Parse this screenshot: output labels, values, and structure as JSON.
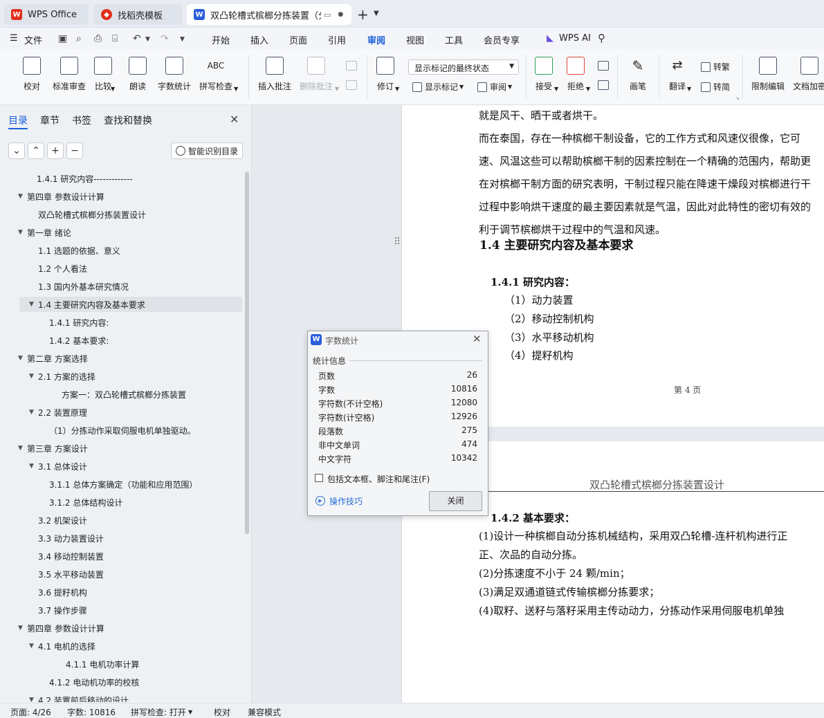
{
  "tabs": [
    {
      "label": "WPS Office",
      "icon": "wps-logo-icon",
      "color": "#e0301e"
    },
    {
      "label": "找稻壳模板",
      "icon": "docer-icon",
      "color": "#e0301e"
    },
    {
      "label": "双凸轮槽式槟榔分拣装置（分",
      "icon": "word-doc-icon",
      "color": "#2b5fd9"
    }
  ],
  "tab_add": "+",
  "menu": {
    "file": "文件",
    "items": [
      "开始",
      "插入",
      "页面",
      "引用",
      "审阅",
      "视图",
      "工具",
      "会员专享"
    ],
    "active": "审阅",
    "ai": "WPS AI"
  },
  "ribbon": {
    "proofread": "校对",
    "standard_review": "标准审查",
    "compare": "比较",
    "read_aloud": "朗读",
    "word_count": "字数统计",
    "spell_check": "拼写检查",
    "insert_comment": "插入批注",
    "delete_comment": "删除批注",
    "revise": "修订",
    "display_dropdown": "显示标记的最终状态",
    "show_markup": "显示标记",
    "review": "审阅",
    "accept": "接受",
    "reject": "拒绝",
    "pen": "画笔",
    "translate": "翻译",
    "to_traditional": "转繁",
    "to_simplified": "转简",
    "restrict_edit": "限制编辑",
    "doc_encrypt": "文档加密"
  },
  "sidebar": {
    "tabs": [
      "目录",
      "章节",
      "书签",
      "查找和替换"
    ],
    "active_tab": "目录",
    "smart_toc": "智能识别目录",
    "toc": [
      {
        "label": "1.4.1  研究内容-------------",
        "level": 1,
        "caret": ""
      },
      {
        "label": "第四章   参数设计计算",
        "level": 0,
        "caret": "▼"
      },
      {
        "label": "双凸轮槽式槟榔分拣装置设计",
        "level": 2,
        "caret": ""
      },
      {
        "label": "第一章  绪论",
        "level": 0,
        "caret": "▼"
      },
      {
        "label": "1.1 选题的依据、意义",
        "level": 2,
        "caret": ""
      },
      {
        "label": "1.2   个人看法",
        "level": 2,
        "caret": ""
      },
      {
        "label": "1.3   国内外基本研究情况",
        "level": 2,
        "caret": ""
      },
      {
        "label": "1.4   主要研究内容及基本要求",
        "level": 2,
        "caret": "▼",
        "selected": true
      },
      {
        "label": "1.4.1    研究内容:",
        "level": 3,
        "caret": ""
      },
      {
        "label": "1.4.2    基本要求:",
        "level": 3,
        "caret": ""
      },
      {
        "label": "第二章  方案选择",
        "level": 0,
        "caret": "▼"
      },
      {
        "label": "2.1  方案的选择",
        "level": 2,
        "caret": "▼"
      },
      {
        "label": "方案一：双凸轮槽式槟榔分拣装置",
        "level": 4,
        "caret": ""
      },
      {
        "label": "2.2  装置原理",
        "level": 2,
        "caret": "▼"
      },
      {
        "label": "（1）分拣动作采取伺服电机单独驱动。",
        "level": 3,
        "caret": ""
      },
      {
        "label": "第三章   方案设计",
        "level": 0,
        "caret": "▼"
      },
      {
        "label": "3.1    总体设计",
        "level": 2,
        "caret": "▼"
      },
      {
        "label": "3.1.1  总体方案确定（功能和应用范围）",
        "level": 3,
        "caret": ""
      },
      {
        "label": "3.1.2  总体结构设计",
        "level": 3,
        "caret": ""
      },
      {
        "label": "3.2   机架设计",
        "level": 2,
        "caret": ""
      },
      {
        "label": "3.3   动力装置设计",
        "level": 2,
        "caret": ""
      },
      {
        "label": "3.4   移动控制装置",
        "level": 2,
        "caret": ""
      },
      {
        "label": "3.5   水平移动装置",
        "level": 2,
        "caret": ""
      },
      {
        "label": "3.6   提籽机构",
        "level": 2,
        "caret": ""
      },
      {
        "label": "3.7   操作步骤",
        "level": 2,
        "caret": ""
      },
      {
        "label": "第四章  参数设计计算",
        "level": 0,
        "caret": "▼"
      },
      {
        "label": "4.1  电机的选择",
        "level": 2,
        "caret": "▼"
      },
      {
        "label": "4.1.1  电机功率计算",
        "level": 5,
        "caret": ""
      },
      {
        "label": "4.1.2  电动机功率的校核",
        "level": 3,
        "caret": ""
      },
      {
        "label": "4.2   装置前后移动的设计",
        "level": 2,
        "caret": "▼"
      }
    ]
  },
  "document": {
    "page1_lines": [
      "就是风干、晒干或者烘干。",
      "      而在泰国，存在一种槟榔干制设备，它的工作方式和风速仪很像，它可",
      "速、风温这些可以帮助槟榔干制的因素控制在一个精确的范围内，帮助更",
      "在对槟榔干制方面的研究表明，干制过程只能在降速干燥段对槟榔进行干",
      "过程中影响烘干速度的最主要因素就是气温，因此对此特性的密切有效的",
      "利于调节槟榔烘干过程中的气温和风速。"
    ],
    "heading_14": "1.4   主要研究内容及基本要求",
    "heading_141": "1.4.1   研究内容：",
    "items": [
      "（1）动力装置",
      "（2）移动控制机构",
      "（3）水平移动机构",
      "（4）提籽机构"
    ],
    "page_footer": "第  4  页",
    "page2_header": "双凸轮槽式槟榔分拣装置设计",
    "heading_142": "1.4.2   基本要求：",
    "page2_lines": [
      "      (1)设计一种槟榔自动分拣机械结构，采用双凸轮槽-连杆机构进行正",
      "正、次品的自动分拣。",
      "      (2)分拣速度不小于 24 颗/min；",
      "      (3)满足双通道链式传输槟榔分拣要求；",
      "      (4)取籽、送籽与落籽采用主传动动力，分拣动作采用伺服电机单独"
    ]
  },
  "dialog": {
    "title": "字数统计",
    "section": "统计信息",
    "stats": [
      {
        "label": "页数",
        "value": "26"
      },
      {
        "label": "字数",
        "value": "10816"
      },
      {
        "label": "字符数(不计空格)",
        "value": "12080"
      },
      {
        "label": "字符数(计空格)",
        "value": "12926"
      },
      {
        "label": "段落数",
        "value": "275"
      },
      {
        "label": "非中文单词",
        "value": "474"
      },
      {
        "label": "中文字符",
        "value": "10342"
      }
    ],
    "checkbox": "包括文本框、脚注和尾注(F)",
    "tips": "操作技巧",
    "close": "关闭"
  },
  "status": {
    "page": "页面: 4/26",
    "words": "字数: 10816",
    "spell": "拼写检查: 打开",
    "proof": "校对",
    "compat": "兼容模式"
  }
}
